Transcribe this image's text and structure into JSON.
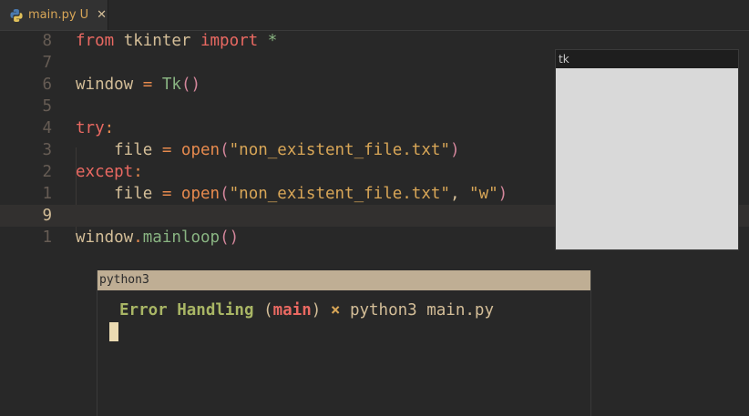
{
  "tab": {
    "filename": "main.py",
    "status": "U",
    "close_glyph": "✕",
    "icon": "python-icon"
  },
  "editor": {
    "lines": [
      {
        "ln": "8",
        "tokens": [
          [
            "kw",
            "from"
          ],
          [
            "t",
            " tkinter "
          ],
          [
            "kw",
            "import"
          ],
          [
            "t",
            " "
          ],
          [
            "fn",
            "*"
          ]
        ]
      },
      {
        "ln": "7",
        "tokens": []
      },
      {
        "ln": "6",
        "tokens": [
          [
            "t",
            "window "
          ],
          [
            "op",
            "="
          ],
          [
            "t",
            " "
          ],
          [
            "fn",
            "Tk"
          ],
          [
            "paren",
            "()"
          ]
        ]
      },
      {
        "ln": "5",
        "tokens": []
      },
      {
        "ln": "4",
        "tokens": [
          [
            "kw",
            "try"
          ],
          [
            "op",
            ":"
          ]
        ]
      },
      {
        "ln": "3",
        "tokens": [
          [
            "t",
            "    file "
          ],
          [
            "op",
            "="
          ],
          [
            "t",
            " "
          ],
          [
            "bi",
            "open"
          ],
          [
            "paren",
            "("
          ],
          [
            "str",
            "\"non_existent_file.txt\""
          ],
          [
            "paren",
            ")"
          ]
        ]
      },
      {
        "ln": "2",
        "tokens": [
          [
            "kw",
            "except"
          ],
          [
            "op",
            ":"
          ]
        ]
      },
      {
        "ln": "1",
        "tokens": [
          [
            "t",
            "    file "
          ],
          [
            "op",
            "="
          ],
          [
            "t",
            " "
          ],
          [
            "bi",
            "open"
          ],
          [
            "paren",
            "("
          ],
          [
            "str",
            "\"non_existent_file.txt\""
          ],
          [
            "t",
            ", "
          ],
          [
            "str",
            "\"w\""
          ],
          [
            "paren",
            ")"
          ]
        ]
      },
      {
        "ln": "9",
        "tokens": [],
        "current": true
      },
      {
        "ln": "1",
        "tokens": [
          [
            "t",
            "window"
          ],
          [
            "op",
            "."
          ],
          [
            "fn",
            "mainloop"
          ],
          [
            "paren",
            "()"
          ]
        ]
      }
    ]
  },
  "tk_window": {
    "title": "tk"
  },
  "terminal": {
    "title": "python3",
    "prompt_dir": "Error Handling",
    "prompt_branch_open": "(",
    "prompt_branch": "main",
    "prompt_branch_close": ")",
    "prompt_sep": "×",
    "command": "python3 main.py"
  },
  "colors": {
    "background": "#282828",
    "keyword": "#ea6962",
    "function": "#89b482",
    "string": "#d8a657",
    "builtin": "#e78a4e"
  }
}
